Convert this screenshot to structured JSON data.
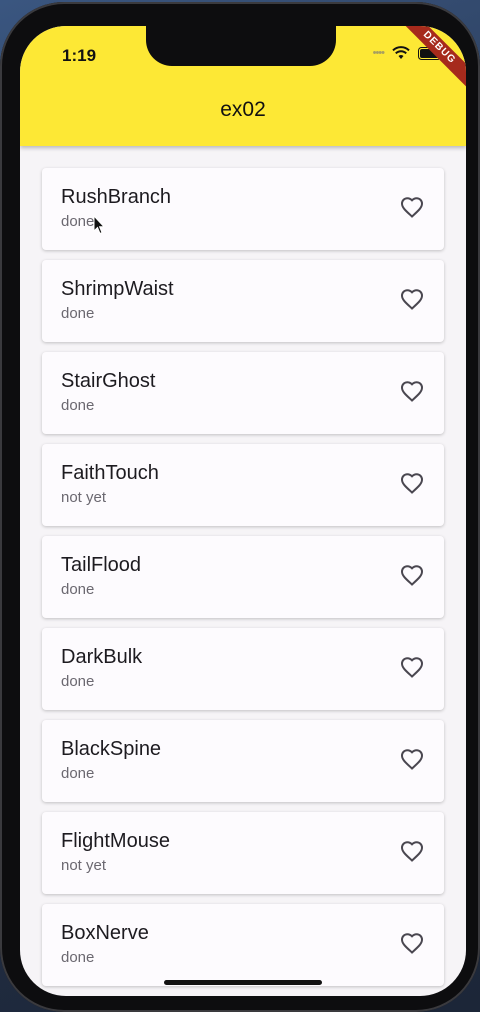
{
  "status_bar": {
    "time": "1:19"
  },
  "app_bar": {
    "title": "ex02",
    "debug_label": "DEBUG"
  },
  "items": [
    {
      "title": "RushBranch",
      "status": "done",
      "icon": "heart-outline-icon"
    },
    {
      "title": "ShrimpWaist",
      "status": "done",
      "icon": "heart-outline-icon"
    },
    {
      "title": "StairGhost",
      "status": "done",
      "icon": "heart-outline-icon"
    },
    {
      "title": "FaithTouch",
      "status": "not yet",
      "icon": "heart-outline-icon"
    },
    {
      "title": "TailFlood",
      "status": "done",
      "icon": "heart-outline-icon"
    },
    {
      "title": "DarkBulk",
      "status": "done",
      "icon": "heart-outline-icon"
    },
    {
      "title": "BlackSpine",
      "status": "done",
      "icon": "heart-outline-icon"
    },
    {
      "title": "FlightMouse",
      "status": "not yet",
      "icon": "heart-outline-icon"
    },
    {
      "title": "BoxNerve",
      "status": "done",
      "icon": "heart-outline-icon"
    }
  ],
  "colors": {
    "app_bar": "#fde835",
    "background": "#f6f4f7",
    "card": "#fdfbfe",
    "debug_banner": "#a62a1c"
  }
}
